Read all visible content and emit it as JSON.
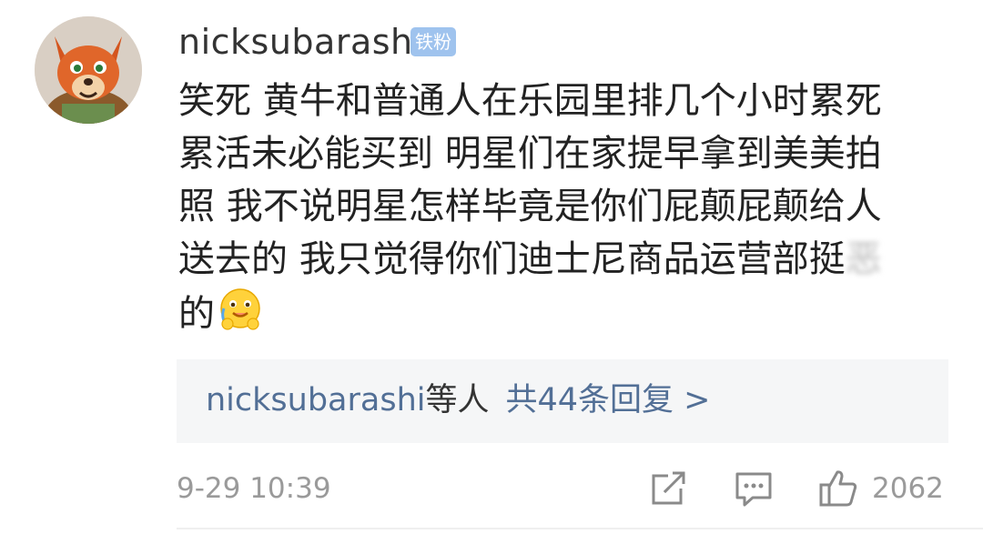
{
  "comment": {
    "username": "nicksubarashi",
    "badge": "铁粉",
    "lines": [
      "笑死 黄牛和普通人在乐园里排几个小时累死",
      "累活未必能买到 明星们在家提早拿到美美拍",
      "照 我不说明星怎样毕竟是你们屁颠屁颠给人"
    ],
    "line4": "送去的 我只觉得你们迪士尼商品运营部挺",
    "line4_blurred": "恶",
    "line5": "的",
    "emoji_icon": "hugging-face-emoji-icon",
    "replies": {
      "users": "nicksubarashi",
      "suffix": "等人",
      "link": "共44条回复 >"
    },
    "time": "9-29 10:39",
    "like_count": "2062",
    "icons": {
      "share": "share-icon",
      "comment": "comment-icon",
      "like": "thumbs-up-icon"
    },
    "colors": {
      "link": "#526f96",
      "badge_bg": "#9fc3ee",
      "meta": "#9a9a9a"
    }
  }
}
